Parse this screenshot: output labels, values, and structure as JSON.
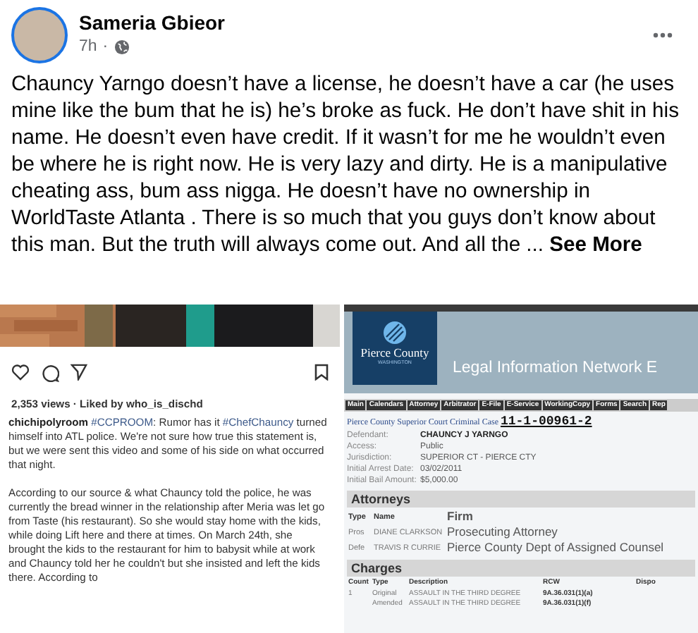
{
  "post": {
    "author": "Sameria Gbieor",
    "time": "7h",
    "separator": "·",
    "text": "Chauncy Yarngo doesn’t have a license, he doesn’t have a car (he uses mine like the bum that he is) he’s broke as fuck. He don’t have shit in his name. He doesn’t even have credit. If it wasn’t for me he wouldn’t even be where he is right now. He is very lazy and dirty. He is a manipulative cheating ass, bum ass nigga. He doesn’t have no ownership in WorldTaste Atlanta . There is so much that you guys don’t know about this man. But the truth will always come out. And all the ...",
    "see_more": "See More"
  },
  "instagram": {
    "views": "2,353 views · Liked by who_is_dischd",
    "caption": [
      {
        "kind": "user",
        "text": "chichipolyroom"
      },
      {
        "kind": "tag",
        "text": " #CCPROOM"
      },
      {
        "kind": "text",
        "text": ": Rumor has it "
      },
      {
        "kind": "tag",
        "text": "#ChefChauncy"
      },
      {
        "kind": "text",
        "text": " turned himself into ATL police. We're not sure how true this statement is, but we were sent this video and some of his side on what occurred that night."
      }
    ],
    "paragraph": "According to our source & what Chauncy told the police, he was currently the bread winner in the relationship after Meria was let go from Taste (his restaurant). So she would stay home with the kids, while doing Lift here and there at times. On March 24th, she brought the kids to the restaurant for him to babysit while at work and Chauncy told her he couldn't but she insisted and left the kids there. According to"
  },
  "court": {
    "logo": {
      "name": "Pierce County",
      "sub": "WASHINGTON"
    },
    "banner_title": "Legal Information Network E",
    "nav": [
      "Main",
      "Calendars",
      "Attorney",
      "Arbitrator",
      "E-File",
      "E-Service",
      "WorkingCopy",
      "Forms",
      "Search",
      "Rep"
    ],
    "case_label": "Pierce County Superior Court Criminal Case",
    "case_number": "11-1-00961-2",
    "fields": [
      {
        "label": "Defendant:",
        "value": "CHAUNCY J YARNGO",
        "strong": true
      },
      {
        "label": "Access:",
        "value": "Public",
        "strong": false
      },
      {
        "label": "Jurisdiction:",
        "value": "SUPERIOR CT - PIERCE CTY",
        "strong": false
      },
      {
        "label": "Initial Arrest Date:",
        "value": "03/02/2011",
        "strong": false
      },
      {
        "label": "Initial Bail Amount:",
        "value": "$5,000.00",
        "strong": false
      }
    ],
    "attorneys": {
      "title": "Attorneys",
      "columns": [
        "Type",
        "Name",
        "Firm"
      ],
      "rows": [
        [
          "Pros",
          "DIANE CLARKSON",
          "Prosecuting Attorney"
        ],
        [
          "Defe",
          "TRAVIS R CURRIE",
          "Pierce County Dept of Assigned Counsel"
        ]
      ]
    },
    "charges": {
      "title": "Charges",
      "columns": [
        "Count",
        "Type",
        "Description",
        "RCW",
        "Dispo"
      ],
      "rows": [
        [
          "1",
          "Original",
          "ASSAULT IN THE THIRD DEGREE",
          "9A.36.031(1)(a)"
        ],
        [
          "",
          "Amended",
          "ASSAULT IN THE THIRD DEGREE",
          "9A.36.031(1)(f)"
        ]
      ]
    }
  }
}
